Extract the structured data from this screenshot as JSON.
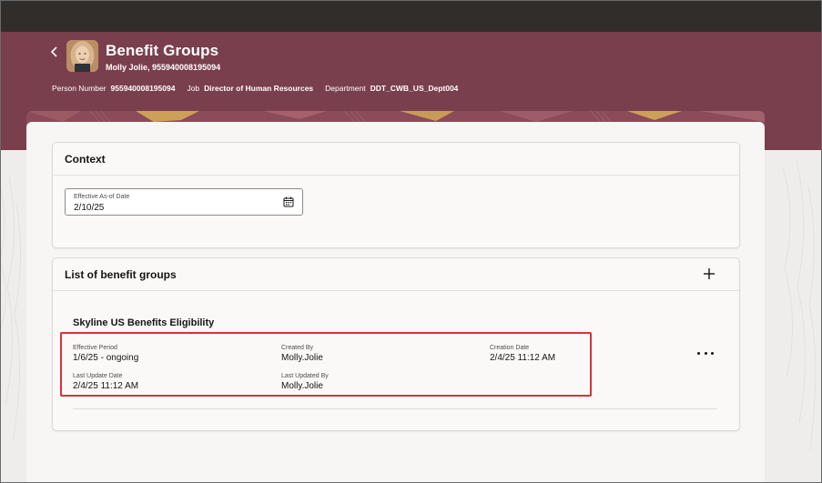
{
  "header": {
    "title": "Benefit Groups",
    "subtitle": "Molly Jolie, 955940008195094",
    "person_number_label": "Person Number",
    "person_number": "955940008195094",
    "job_label": "Job",
    "job": "Director of Human Resources",
    "department_label": "Department",
    "department": "DDT_CWB_US_Dept004"
  },
  "context": {
    "title": "Context",
    "date_label": "Effective As-of Date",
    "date_value": "2/10/25"
  },
  "benefit_groups": {
    "title": "List of benefit groups",
    "group": {
      "name": "Skyline US Benefits Eligibility",
      "effective_period_label": "Effective Period",
      "effective_period": "1/6/25 - ongoing",
      "created_by_label": "Created By",
      "created_by": "Molly.Jolie",
      "creation_date_label": "Creation Date",
      "creation_date": "2/4/25 11:12 AM",
      "last_update_date_label": "Last Update Date",
      "last_update_date": "2/4/25 11:12 AM",
      "last_updated_by_label": "Last Updated By",
      "last_updated_by": "Molly.Jolie"
    }
  },
  "icons": {
    "back": "chevron-left-icon",
    "calendar": "calendar-icon",
    "add": "plus-icon",
    "more": "more-actions-icon"
  },
  "colors": {
    "header": "#7a3f4c",
    "topbar": "#312d2a",
    "highlight": "#d9323a"
  }
}
